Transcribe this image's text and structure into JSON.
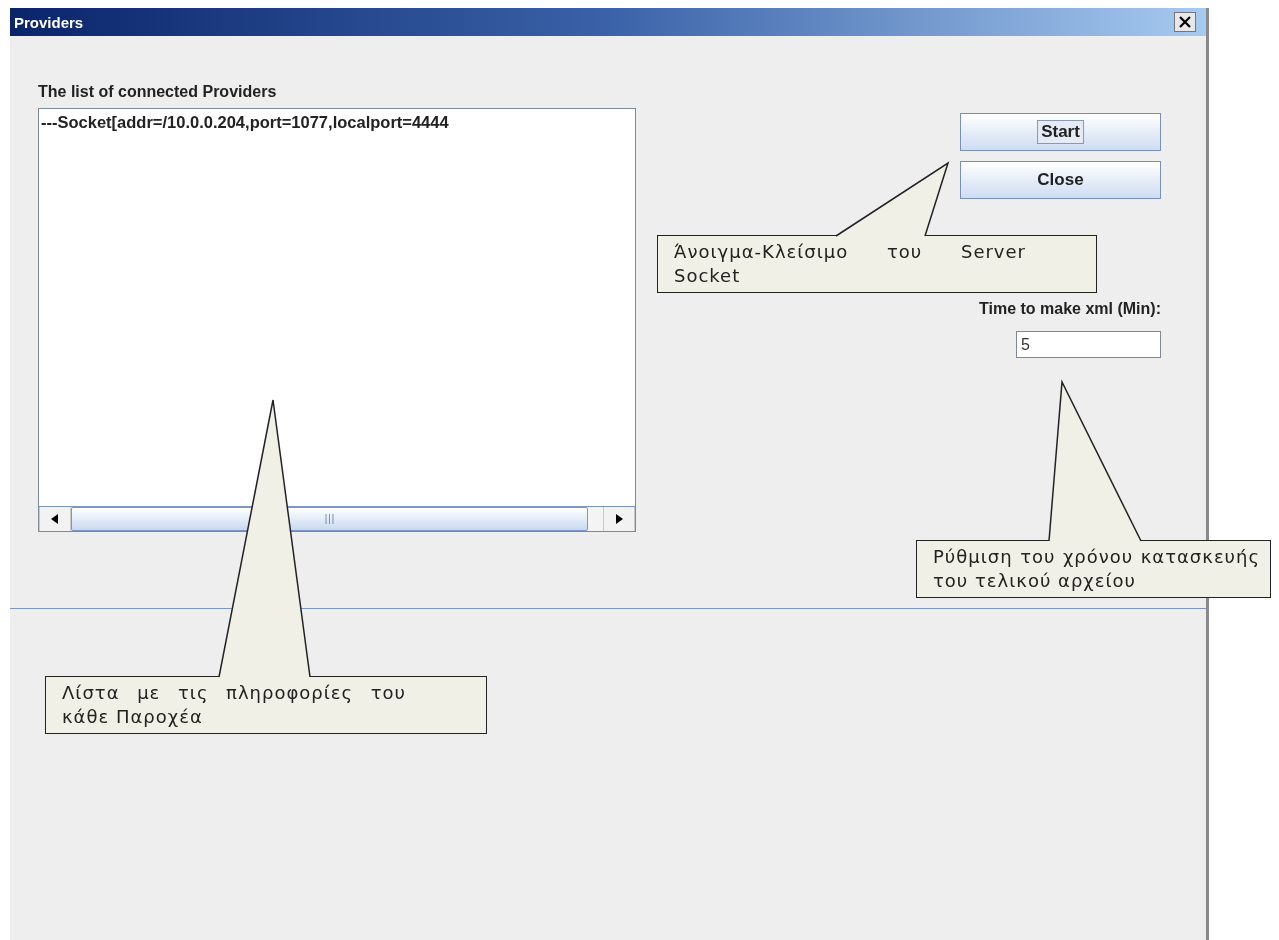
{
  "window": {
    "title": "Providers"
  },
  "providers": {
    "label": "The list of connected Providers",
    "items": [
      "---Socket[addr=/10.0.0.204,port=1077,localport=4444"
    ]
  },
  "buttons": [
    {
      "label": "Start",
      "focused": true
    },
    {
      "label": "Close",
      "focused": false
    }
  ],
  "xml_time": {
    "label": "Time to make xml (Min):",
    "value": "5"
  },
  "callouts": [
    "Άνοιγμα-Κλείσιμο του Server Socket",
    "Ρύθμιση του χρόνου κατασκευής του τελικού αρχείου",
    "Λίστα με τις πληροφορίες του κάθε Παροχέα"
  ]
}
